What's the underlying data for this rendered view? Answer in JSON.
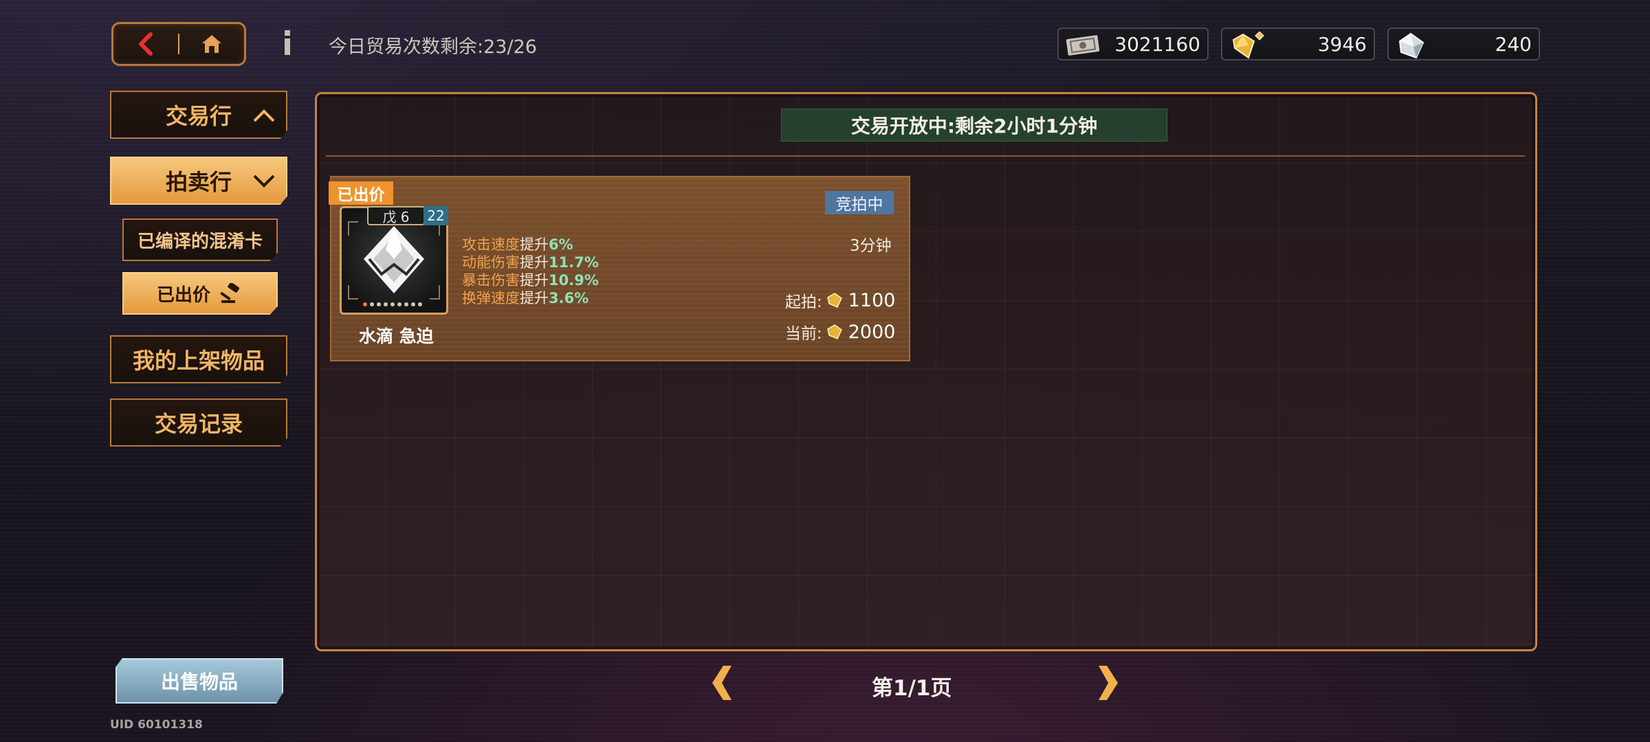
{
  "topbar": {
    "trade_count_label": "今日贸易次数剩余:",
    "trade_count_value": "23/26",
    "currencies": [
      {
        "icon": "cash-ticket-icon",
        "value": "3021160"
      },
      {
        "icon": "gold-crystal-icon",
        "value": "3946"
      },
      {
        "icon": "silver-crystal-icon",
        "value": "240"
      }
    ]
  },
  "sidebar": {
    "trade_label": "交易行",
    "auction_label": "拍卖行",
    "sub_items": [
      {
        "label": "已编译的混淆卡"
      },
      {
        "label": "已出价"
      }
    ],
    "my_listings_label": "我的上架物品",
    "trade_log_label": "交易记录",
    "sell_label": "出售物品",
    "uid": "UID 60101318"
  },
  "main": {
    "status_banner": "交易开放中:剩余2小时1分钟",
    "card": {
      "bid_tag": "已出价",
      "status": "竞拍中",
      "time_left": "3分钟",
      "grade": "戊 6",
      "level": "22",
      "name": "水滴 急迫",
      "stats": [
        {
          "name": "攻击速度",
          "verb": "提升",
          "value": "6%"
        },
        {
          "name": "动能伤害",
          "verb": "提升",
          "value": "11.7%"
        },
        {
          "name": "暴击伤害",
          "verb": "提升",
          "value": "10.9%"
        },
        {
          "name": "换弹速度",
          "verb": "提升",
          "value": "3.6%"
        }
      ],
      "start_label": "起拍:",
      "start_price": "1100",
      "current_label": "当前:",
      "current_price": "2000"
    }
  },
  "pagination": {
    "text": "第1/1页"
  },
  "colors": {
    "accent": "#e49a3e",
    "panel_border": "#c8843e",
    "banner": "#25402e",
    "stat_value": "#8ee0b8"
  }
}
